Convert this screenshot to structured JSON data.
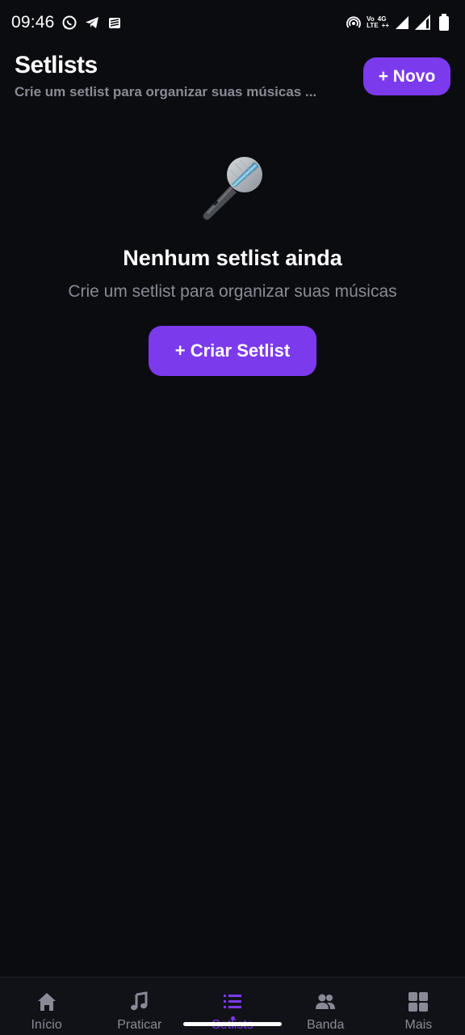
{
  "status_bar": {
    "time": "09:46",
    "left_icons": [
      "whatsapp-icon",
      "telegram-icon",
      "stack-app-icon"
    ],
    "right_icons": [
      "hotspot-icon",
      "volte-4g-icon",
      "signal-icon",
      "signal-icon",
      "battery-icon"
    ],
    "volte_top": "Vo",
    "volte_bottom": "LTE",
    "net_top": "4G",
    "net_bottom": "++"
  },
  "header": {
    "title": "Setlists",
    "subtitle": "Crie um setlist para organizar suas músicas ...",
    "new_button_label": "+ Novo"
  },
  "empty_state": {
    "icon": "microphone-icon",
    "title": "Nenhum setlist ainda",
    "subtitle": "Crie um setlist para organizar suas músicas",
    "create_button_label": "+ Criar Setlist"
  },
  "bottom_nav": {
    "items": [
      {
        "label": "Início",
        "icon": "home-icon",
        "active": false
      },
      {
        "label": "Praticar",
        "icon": "music-note-icon",
        "active": false
      },
      {
        "label": "Setlists",
        "icon": "list-icon",
        "active": true
      },
      {
        "label": "Banda",
        "icon": "people-icon",
        "active": false
      },
      {
        "label": "Mais",
        "icon": "grid-icon",
        "active": false
      }
    ]
  },
  "colors": {
    "accent": "#7c3aed",
    "background": "#0b0c10",
    "muted_text": "#8a8a96",
    "nav_background": "#111218"
  }
}
